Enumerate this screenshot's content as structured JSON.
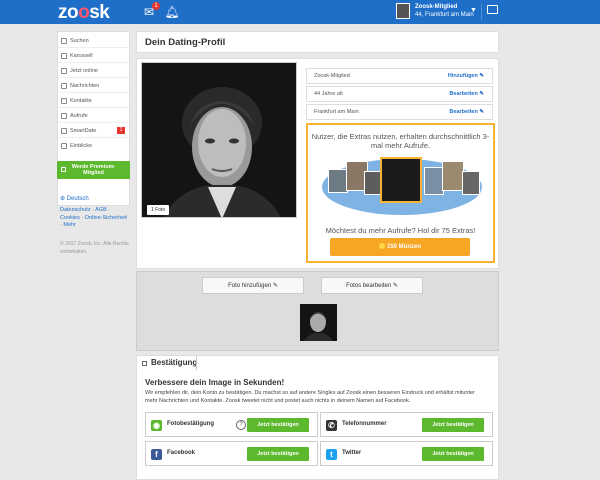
{
  "header": {
    "logo": "zoosk",
    "badge_count": "1",
    "user": {
      "name": "Zoosk-Mitglied",
      "location": "44, Frankfurt am Main"
    }
  },
  "sidebar": {
    "items": [
      {
        "label": "Suchen",
        "icon": "search-icon"
      },
      {
        "label": "Karussell",
        "icon": "carousel-icon"
      },
      {
        "label": "Jetzt online",
        "icon": "online-icon"
      },
      {
        "label": "Nachrichten",
        "icon": "messages-icon"
      },
      {
        "label": "Kontakte",
        "icon": "contacts-icon"
      },
      {
        "label": "Aufrufe",
        "icon": "views-icon"
      },
      {
        "label": "SmartDate",
        "icon": "smartdate-icon",
        "badge": "1"
      },
      {
        "label": "Einblicke",
        "icon": "insights-icon"
      }
    ],
    "premium_label": "Werde Premium-Mitglied",
    "language": "Deutsch",
    "footer_links": "Datenschutz · AGB · Cookies · Online-Sicherheit · Mehr",
    "copyright": "© 2017 Zoosk, Inc. Alle Rechte vorbehalten."
  },
  "profile": {
    "title": "Dein Dating-Profil",
    "photo_badge": "1 Foto",
    "rows": [
      {
        "label": "Zoosk-Mitglied",
        "action": "Hinzufügen"
      },
      {
        "label": "44 Jahre alt",
        "action": "Bearbeiten"
      },
      {
        "label": "Frankfurt am Main",
        "action": "Bearbeiten"
      }
    ],
    "promo": {
      "headline": "Nutzer, die Extras nutzen, erhalten durchschnittlich 3-mal mehr Aufrufe.",
      "question": "Möchtest du mehr Aufrufe? Hol dir 75 Extras!",
      "button": "150 Münzen"
    }
  },
  "photos": {
    "add_label": "Foto hinzufügen",
    "edit_label": "Fotos bearbeiten"
  },
  "verification": {
    "tab": "Bestätigung",
    "headline": "Verbessere dein Image in Sekunden!",
    "text": "Wir empfehlen dir, dein Konto zu bestätigen. Du machst so auf andere Singles auf Zoosk einen besseren Eindruck und erhältst mitunter mehr Nachrichten und Kontakte. Zoosk tweetet nicht und postet auch nichts in deinem Namen auf Facebook.",
    "items": [
      {
        "label": "Fotobestätigung",
        "button": "Jetzt bestätigen",
        "icon": "camera-icon",
        "color": "#5cb82c"
      },
      {
        "label": "Telefonnummer",
        "button": "Jetzt bestätigen",
        "icon": "phone-icon",
        "color": "#333333"
      },
      {
        "label": "Facebook",
        "button": "Jetzt bestätigen",
        "icon": "facebook-icon",
        "color": "#3b5998"
      },
      {
        "label": "Twitter",
        "button": "Jetzt bestätigen",
        "icon": "twitter-icon",
        "color": "#1da1f2"
      }
    ]
  },
  "colors": {
    "brand": "#1f6fc9",
    "accent": "#f6a623",
    "green": "#5cb82c"
  }
}
